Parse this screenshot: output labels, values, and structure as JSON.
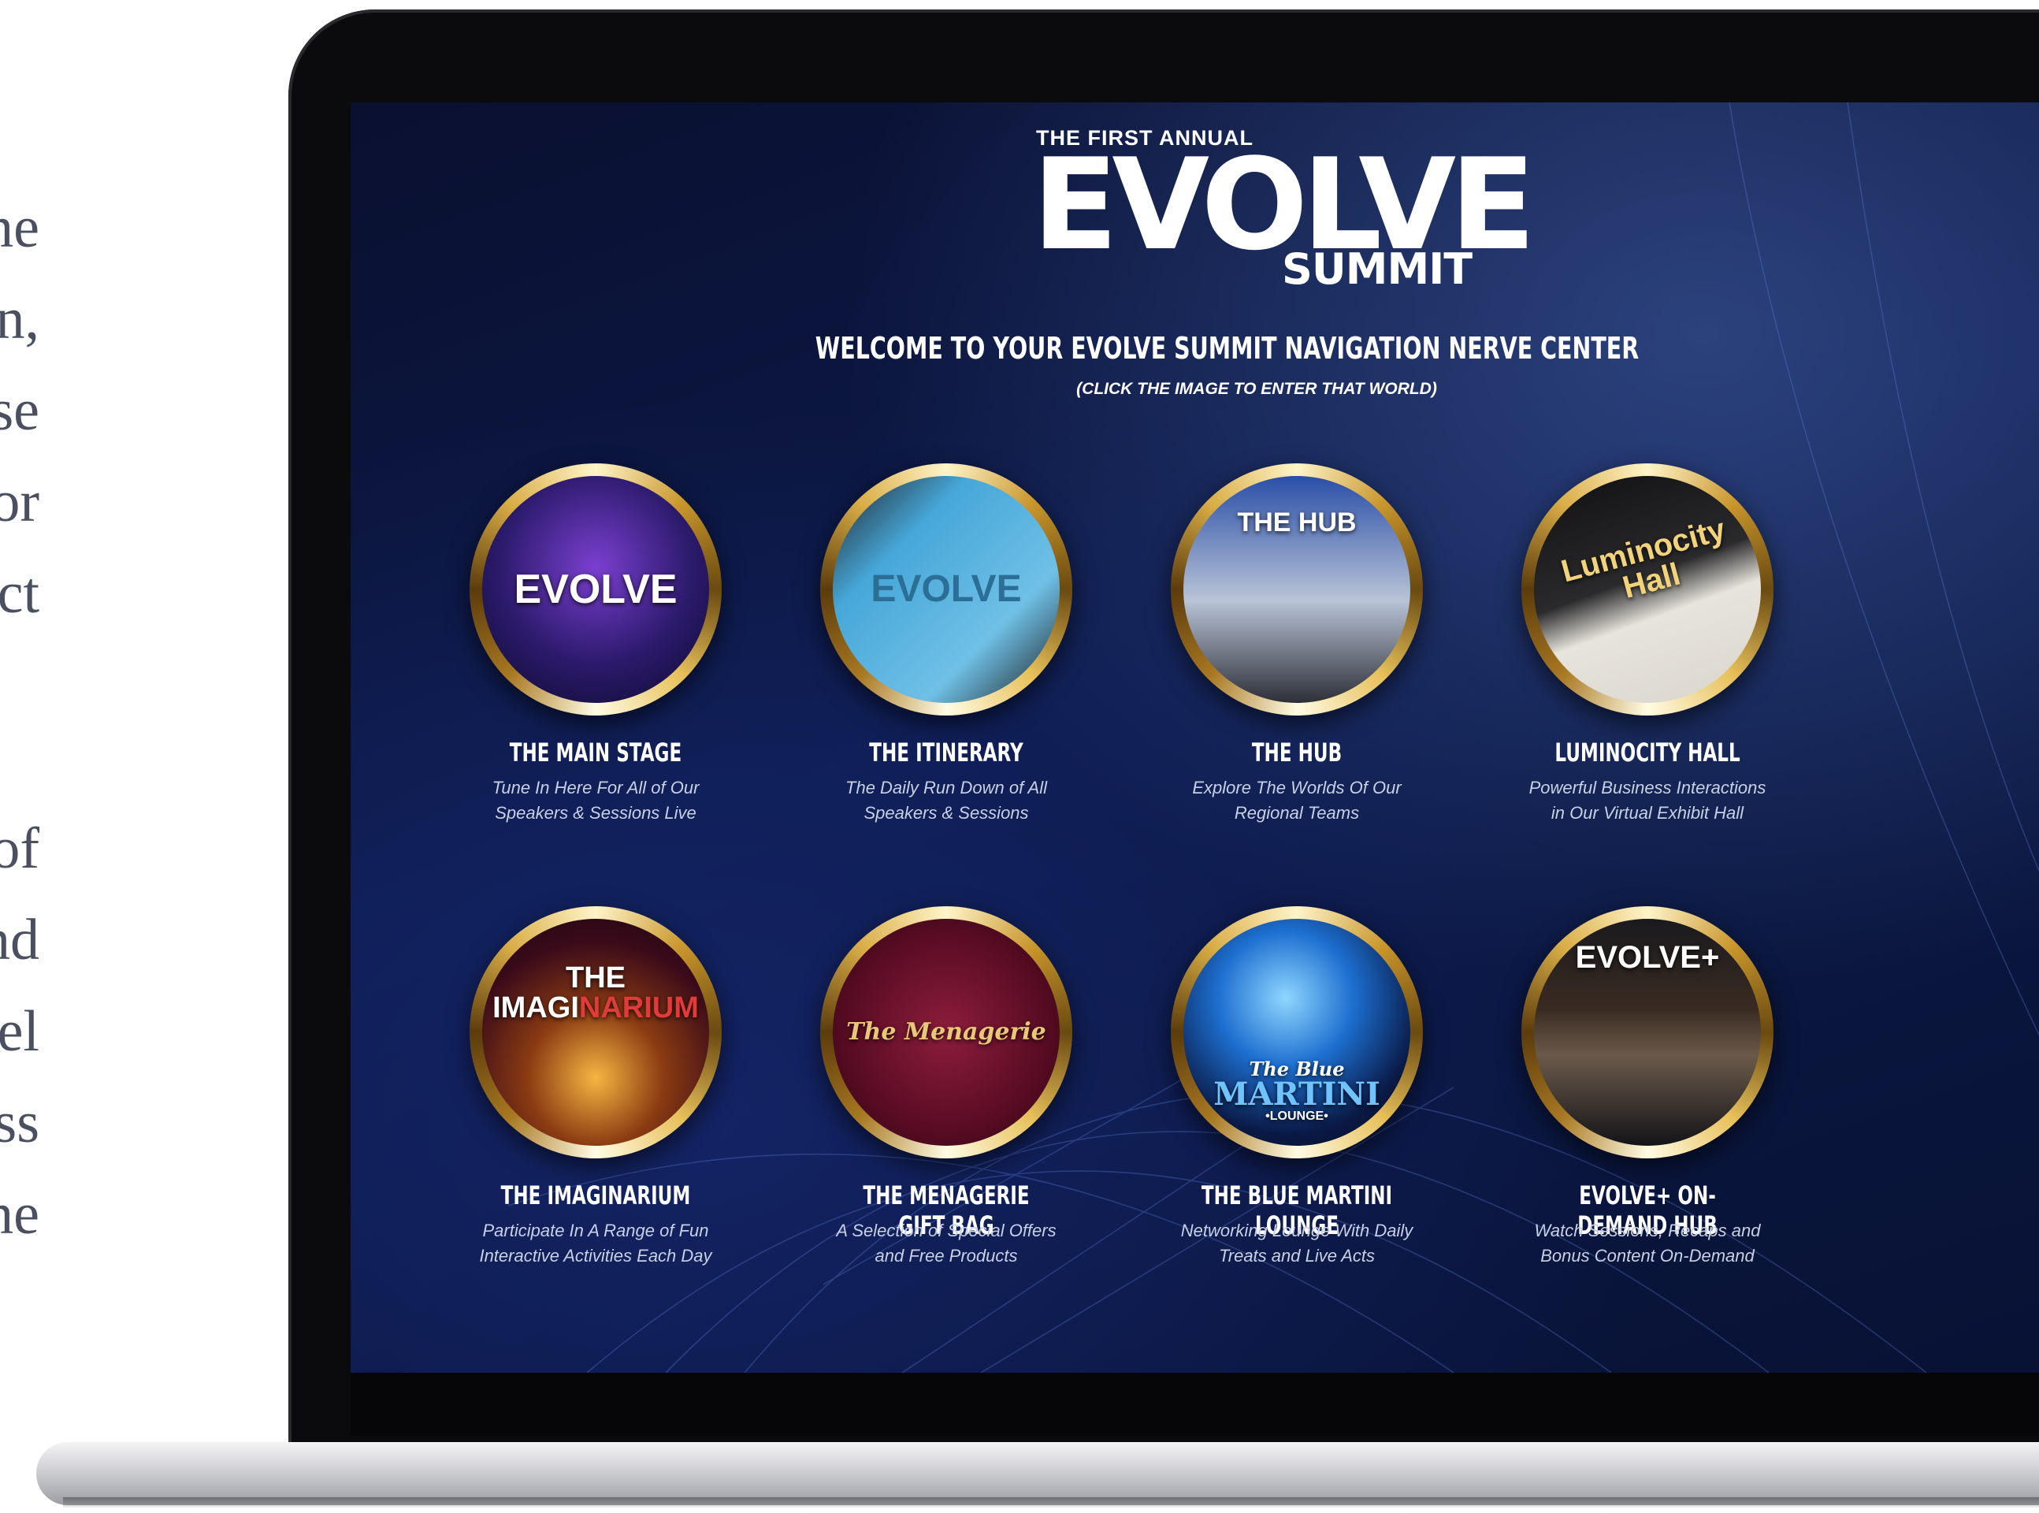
{
  "side_text": {
    "lines": [
      "ne",
      "n,",
      "se",
      "or",
      "ct",
      "of",
      "nd",
      "el",
      "ss",
      "ne"
    ]
  },
  "header": {
    "pre_title": "THE FIRST ANNUAL",
    "logo_title": "EVOLVE",
    "logo_subtitle": "SUMMIT",
    "welcome": "WELCOME TO YOUR EVOLVE SUMMIT NAVIGATION NERVE CENTER",
    "instruction": "(CLICK THE IMAGE TO ENTER THAT WORLD)"
  },
  "tiles": [
    {
      "title": "THE MAIN STAGE",
      "desc_line1": "Tune In Here For All of Our",
      "desc_line2": "Speakers & Sessions Live",
      "image_label": "EVOLVE",
      "icon": "main-stage-image"
    },
    {
      "title": "THE ITINERARY",
      "desc_line1": "The Daily Run Down of All",
      "desc_line2": "Speakers & Sessions",
      "image_label": "EVOLVE",
      "icon": "itinerary-image"
    },
    {
      "title": "THE HUB",
      "desc_line1": "Explore The Worlds Of Our",
      "desc_line2": "Regional Teams",
      "image_label": "THE HUB",
      "icon": "hub-image"
    },
    {
      "title": "LUMINOCITY HALL",
      "desc_line1": "Powerful Business Interactions",
      "desc_line2": "in Our Virtual Exhibit Hall",
      "image_label": "Luminocity Hall",
      "icon": "luminocity-hall-image"
    },
    {
      "title": "THE IMAGINARIUM",
      "desc_line1": "Participate In A Range of Fun",
      "desc_line2": "Interactive Activities Each Day",
      "image_label_1": "THE",
      "image_label_2a": "IMAGI",
      "image_label_2b": "NARIUM",
      "icon": "imaginarium-image"
    },
    {
      "title": "THE MENAGERIE GIFT BAG",
      "desc_line1": "A Selection of Special Offers",
      "desc_line2": "and Free Products",
      "image_label": "The Menagerie",
      "icon": "gift-bag-image"
    },
    {
      "title": "THE BLUE MARTINI LOUNGE",
      "desc_line1": "Networking Lounge With Daily",
      "desc_line2": "Treats and Live Acts",
      "image_label_1": "The Blue",
      "image_label_2": "MARTINI",
      "image_label_3": "•LOUNGE•",
      "icon": "martini-image"
    },
    {
      "title": "EVOLVE+ ON-DEMAND HUB",
      "desc_line1": "Watch Sessions, Recaps and",
      "desc_line2": "Bonus Content On-Demand",
      "image_label": "EVOLVE+",
      "icon": "on-demand-image"
    }
  ],
  "colors": {
    "screen_bg": "#0c1a4a",
    "gold_ring": "#c9962c",
    "text": "#ffffff"
  }
}
